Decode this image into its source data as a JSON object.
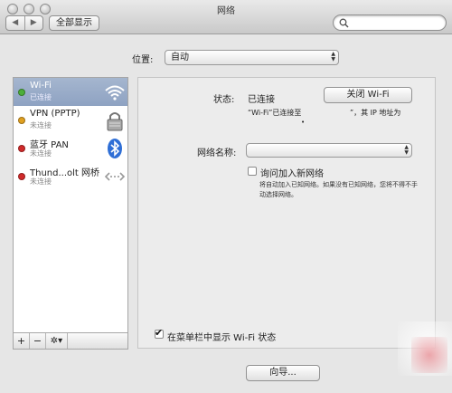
{
  "window": {
    "title": "网络"
  },
  "toolbar": {
    "back": "◀",
    "forward": "▶",
    "show_all": "全部显示",
    "search_placeholder": ""
  },
  "location": {
    "label": "位置:",
    "value": "自动"
  },
  "services": [
    {
      "name": "Wi-Fi",
      "status": "已连接",
      "dot_color": "#4caf3a",
      "icon": "wifi-icon",
      "selected": true
    },
    {
      "name": "VPN (PPTP)",
      "status": "未连接",
      "dot_color": "#e0a020",
      "icon": "lock-icon",
      "selected": false
    },
    {
      "name": "蓝牙 PAN",
      "status": "未连接",
      "dot_color": "#d02a2a",
      "icon": "bluetooth-icon",
      "selected": false
    },
    {
      "name": "Thund...olt 网桥",
      "status": "未连接",
      "dot_color": "#d02a2a",
      "icon": "bridge-icon",
      "selected": false
    }
  ],
  "sidebar_tools": {
    "add": "+",
    "remove": "−",
    "gear": "✲▾"
  },
  "detail": {
    "status_label": "状态:",
    "status_value": "已连接",
    "turn_off_button": "关闭 Wi-Fi",
    "connected_text_a": "“Wi-Fi”已连接至",
    "connected_text_b": "”，其 IP 地址为",
    "dot": "•",
    "network_name_label": "网络名称:",
    "network_name_value": "",
    "ask_join_label": "询问加入新网络",
    "ask_join_desc": "将自动加入已知网络。如果没有已知网络，您将不得不手动选择网络。",
    "ask_join_checked": false,
    "show_in_menu_label": "在菜单栏中显示 Wi-Fi 状态",
    "show_in_menu_checked": true
  },
  "assistant_button": "向导..."
}
